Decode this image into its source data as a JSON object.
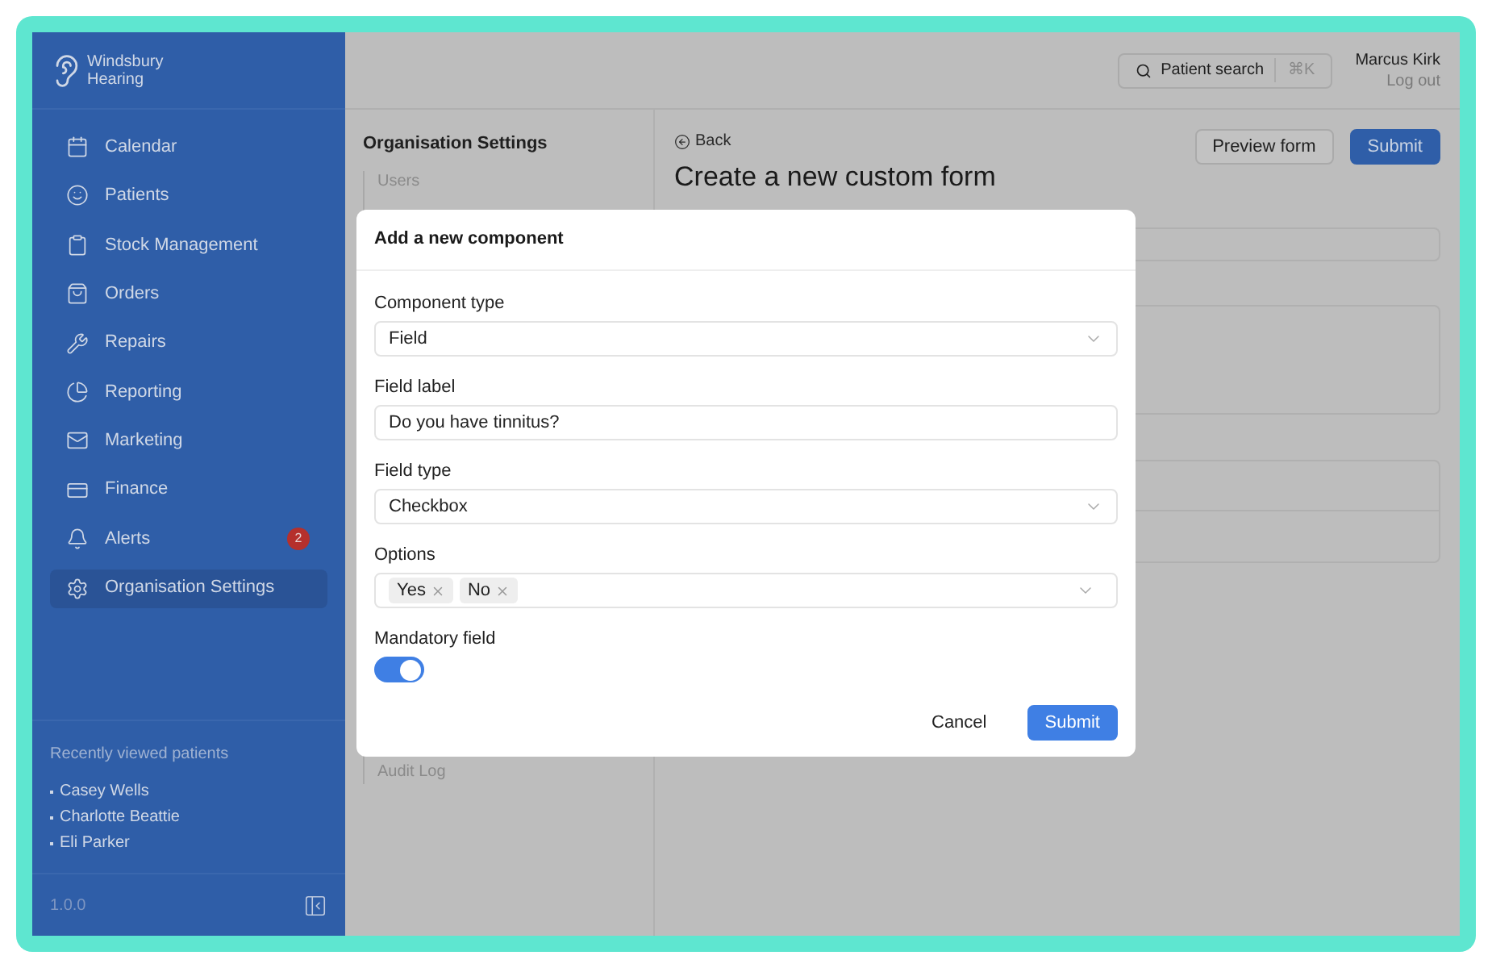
{
  "brand": {
    "lines": [
      "Windsbury",
      "Hearing"
    ]
  },
  "nav": [
    {
      "label": "Calendar",
      "selected": false
    },
    {
      "label": "Patients",
      "selected": false
    },
    {
      "label": "Stock Management",
      "selected": false
    },
    {
      "label": "Orders",
      "selected": false
    },
    {
      "label": "Repairs",
      "selected": false
    },
    {
      "label": "Reporting",
      "selected": false
    },
    {
      "label": "Marketing",
      "selected": false
    },
    {
      "label": "Finance",
      "selected": false
    },
    {
      "label": "Alerts",
      "selected": false,
      "badge": "2"
    },
    {
      "label": "Organisation Settings",
      "selected": true
    }
  ],
  "recent": {
    "heading": "Recently viewed patients",
    "patients": [
      "Casey Wells",
      "Charlotte Beattie",
      "Eli Parker"
    ]
  },
  "version": "1.0.0",
  "topbar": {
    "search": {
      "label": "Patient search",
      "shortcut": "⌘K"
    },
    "user": {
      "name": "Marcus Kirk",
      "logout": "Log out"
    }
  },
  "settings_nav": {
    "title": "Organisation Settings",
    "items": [
      "Users",
      "Audit Log"
    ]
  },
  "page": {
    "back": "Back",
    "title": "Create a new custom form",
    "buttons": [
      {
        "label": "Preview form",
        "kind": "secondary"
      },
      {
        "label": "Submit",
        "kind": "primary"
      }
    ]
  },
  "modal": {
    "title": "Add a new component",
    "fields": [
      {
        "kind": "select",
        "label": "Component type",
        "value": "Field"
      },
      {
        "kind": "text",
        "label": "Field label",
        "value": "Do you have tinnitus?"
      },
      {
        "kind": "select",
        "label": "Field type",
        "value": "Checkbox"
      },
      {
        "kind": "tags",
        "label": "Options",
        "tags": [
          "Yes",
          "No"
        ]
      },
      {
        "kind": "switch",
        "label": "Mandatory field",
        "on": true
      }
    ],
    "buttons": [
      {
        "label": "Cancel",
        "kind": "secondary"
      },
      {
        "label": "Submit",
        "kind": "primary"
      }
    ]
  }
}
